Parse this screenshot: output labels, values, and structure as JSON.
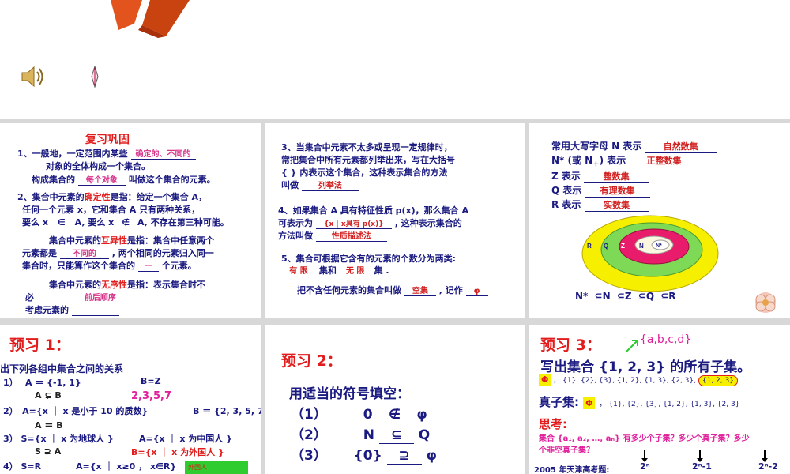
{
  "header": {
    "bg": "#ffffff"
  },
  "panels": {
    "review": {
      "title": "复习巩固",
      "l1a": "1、一般地，一定范围内某些",
      "l1_fill": "确定的、不同的",
      "l1b": "对象的全体构成一个集合。",
      "l2a": "构成集合的",
      "l2_fill": "每个对象",
      "l2b": "叫做这个集合的元素。",
      "l3a": "2、集合中元素的",
      "l3_hl": "确定性",
      "l3b": "是指：给定一个集合 A，",
      "l4": "任何一个元素 x，它和集合 A 只有两种关系，",
      "l5a": "要么 x",
      "l5_sym1": "∈",
      "l5b": "A, 要么 x",
      "l5_sym2": "∉",
      "l5c": "A, 不存在第三种可能。",
      "l6a": "集合中元素的",
      "l6_hl": "互异性",
      "l6b": "是指：集合中任意两个",
      "l7a": "元素都是",
      "l7_fill": "不同的",
      "l7b": ", 两个相同的元素归入同一",
      "l8a": "集合时，只能算作这个集合的",
      "l8_fill": "一",
      "l8b": "个元素。",
      "l9a": "集合中元素的",
      "l9_hl": "无序性",
      "l9b": "是指：表示集合时不",
      "l10a": "必",
      "l10_fill": "前后顺序",
      "l11": "考虑元素的"
    },
    "methods": {
      "l1": "3、当集合中元素不太多或呈现一定规律时，",
      "l2": "常把集合中所有元素都列举出来，写在大括号",
      "l3": "{ } 内表示这个集合，这种表示集合的方法",
      "l4a": "叫做",
      "l4_fill": "列举法",
      "l5": "4、如果集合 A 具有特征性质 p(x)，那么集合 A",
      "l6a": "可表示为",
      "l6_fill": "{x | x具有 p(x)}",
      "l6b": ", 这种表示集合的",
      "l7a": "方法叫做",
      "l7_fill": "性质描述法",
      "l8": "5、集合可根据它含有的元素的个数分为两类:",
      "l9_fill1": "有 限",
      "l9a": "集和",
      "l9_fill2": "无 限",
      "l9b": "集 .",
      "l10a": "把不含任何元素的集合叫做",
      "l10_fill": "空集",
      "l10b": ", 记作",
      "l10_fill2": "φ"
    },
    "numbers": {
      "r1a": "常用大写字母 N 表示",
      "r1_fill": "自然数集",
      "r2a": "N* (或 N",
      "r2_sub": "+",
      "r2b": ") 表示",
      "r2_fill": "正整数集",
      "r3a": "Z 表示",
      "r3_fill": "整数集",
      "r4a": "Q 表示",
      "r4_fill": "有理数集",
      "r5a": "R 表示",
      "r5_fill": "实数集",
      "ring_labels": [
        "R",
        "Q",
        "Z",
        "N",
        "N*"
      ],
      "chain": [
        "N*",
        "⊆",
        "N",
        "⊆",
        "Z",
        "⊆",
        "Q",
        "⊆",
        "R"
      ]
    },
    "pre1": {
      "title": "预习 1：",
      "instruction": "出下列各组中集合之间的关系",
      "q1a": "1）　 A ＝ {-1, 1}",
      "q1b": "B=Z",
      "q1_ans": "A ⊊ B",
      "q1_note": "2,3,5,7",
      "q2a": "2）　A={x ｜ x 是小于 10 的质数}",
      "q2b": "B ＝ {2, 3, 5, 7",
      "q2_ans": "A ＝ B",
      "q3a": "3） S={x ｜ x 为地球人 }",
      "q3b": "A={x ｜ x 为中国人 }",
      "q3_ans": "S ⊋ A",
      "q3_note": "B={x ｜ x 为外国人 }",
      "q4a": "4） S=R",
      "q4b": "A={x ｜ x≥0 ， x∈R}",
      "q4_box": "外国人"
    },
    "pre2": {
      "title": "预习 2：",
      "instruction": "用适当的符号填空：",
      "rows": [
        {
          "num": "（1）",
          "left": "0",
          "sym": "∉",
          "right": "φ"
        },
        {
          "num": "（2）",
          "left": "N",
          "sym": "⊆",
          "right": "Q"
        },
        {
          "num": "（3）",
          "left": "{0}",
          "sym": "⊇",
          "right": "φ"
        }
      ]
    },
    "pre3": {
      "title": "预习 3：",
      "note": "{a,b,c,d}",
      "heading": "写出集合 {1, 2, 3} 的所有子集。",
      "subsets": "Φ ， {1}, {2}, {3}, {1, 2}, {1, 3}, {2, 3}, {1, 2, 3}",
      "phi": "Φ",
      "subsets_rest": "，  {1}, {2}, {3}, {1, 2}, {1, 3}, {2, 3},",
      "last_subset": "{1, 2, 3}",
      "proper_label": "真子集:",
      "proper_phi": "Φ",
      "proper_rest": "，  {1}, {2}, {3}, {1, 2}, {1, 3}, {2, 3}",
      "think_label": "思考:",
      "think_q1": "集合 {a₁, a₂, …, aₙ} 有多少个子集？多少个真子集？多少",
      "think_q2": "个非空真子集？",
      "exam": "2005 年天津高考题:",
      "ans1": "2ⁿ",
      "ans2": "2ⁿ-1",
      "ans3": "2ⁿ-2"
    }
  },
  "colors": {
    "panel_bg": "#ffffff",
    "divider": "#d8d8d8",
    "dark_blue": "#1a1a80",
    "magenta": "#d6338a",
    "red": "#e21c1c",
    "orange_logo": "#e2531e"
  },
  "icons": [
    "orange-logo-shape",
    "speaker-icon",
    "cursor-icon",
    "flower-icon"
  ]
}
